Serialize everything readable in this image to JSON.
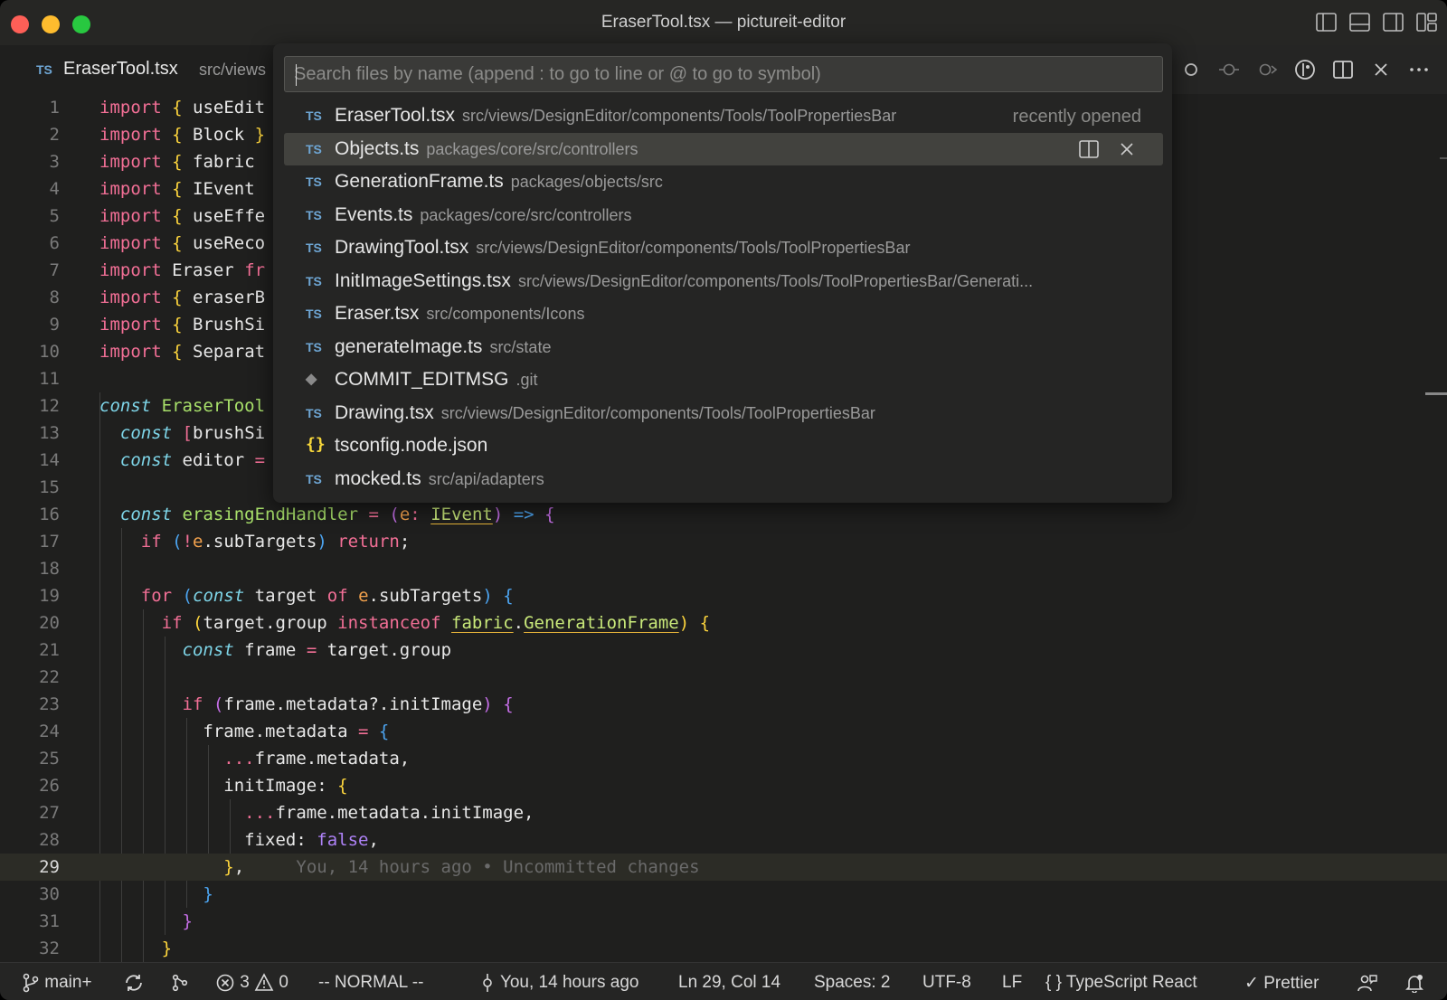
{
  "window": {
    "title": "EraserTool.tsx — pictureit-editor"
  },
  "tab": {
    "icon": "TS",
    "name": "EraserTool.tsx",
    "path": "src/views"
  },
  "quickopen": {
    "placeholder": "Search files by name (append : to go to line or @ to go to symbol)",
    "items": [
      {
        "icon": "TS",
        "name": "EraserTool.tsx",
        "desc": "src/views/DesignEditor/components/Tools/ToolPropertiesBar",
        "right": "recently opened"
      },
      {
        "icon": "TS",
        "name": "Objects.ts",
        "desc": "packages/core/src/controllers"
      },
      {
        "icon": "TS",
        "name": "GenerationFrame.ts",
        "desc": "packages/objects/src"
      },
      {
        "icon": "TS",
        "name": "Events.ts",
        "desc": "packages/core/src/controllers"
      },
      {
        "icon": "TS",
        "name": "DrawingTool.tsx",
        "desc": "src/views/DesignEditor/components/Tools/ToolPropertiesBar"
      },
      {
        "icon": "TS",
        "name": "InitImageSettings.tsx",
        "desc": "src/views/DesignEditor/components/Tools/ToolPropertiesBar/Generati..."
      },
      {
        "icon": "TS",
        "name": "Eraser.tsx",
        "desc": "src/components/Icons"
      },
      {
        "icon": "TS",
        "name": "generateImage.ts",
        "desc": "src/state"
      },
      {
        "icon": "◆",
        "name": "COMMIT_EDITMSG",
        "desc": ".git"
      },
      {
        "icon": "TS",
        "name": "Drawing.tsx",
        "desc": "src/views/DesignEditor/components/Tools/ToolPropertiesBar"
      },
      {
        "icon": "{}",
        "name": "tsconfig.node.json",
        "desc": ""
      },
      {
        "icon": "TS",
        "name": "mocked.ts",
        "desc": "src/api/adapters"
      }
    ]
  },
  "editor": {
    "line_numbers": [
      "1",
      "2",
      "3",
      "4",
      "5",
      "6",
      "7",
      "8",
      "9",
      "10",
      "11",
      "12",
      "13",
      "14",
      "15",
      "16",
      "17",
      "18",
      "19",
      "20",
      "21",
      "22",
      "23",
      "24",
      "25",
      "26",
      "27",
      "28",
      "29",
      "30",
      "31",
      "32"
    ],
    "current_line": "29",
    "code": {
      "l1_a": "useEdit",
      "l2_a": "Block",
      "l3_a": "fabric",
      "l4_a": "IEvent",
      "l5_a": "useEffe",
      "l6_a": "useReco",
      "l7_a": "Eraser",
      "l7_b": "fr",
      "l8_a": "eraserB",
      "l9_a": "BrushSi",
      "l10_a": "Separat",
      "l12_a": "EraserTool",
      "l13_a": "brushSi",
      "l14_a": "editor",
      "l16_a": "erasingEndHandler",
      "l16_b": "e",
      "l16_c": "IEvent",
      "l17_a": "e",
      "l17_b": ".subTargets",
      "l19_a": "target",
      "l19_b": "e",
      "l19_c": ".subTargets",
      "l20_a": "target.group",
      "l20_b": "fabric",
      "l20_c": "GenerationFrame",
      "l21_a": "frame",
      "l21_b": "target.group",
      "l23_a": "frame.metadata?.initImage",
      "l24_a": "frame.metadata",
      "l25_a": "frame.metadata,",
      "l26_a": "initImage:",
      "l27_a": "frame.metadata.initImage,",
      "l28_a": "fixed:",
      "l28_b": "false",
      "l29_blame": "You, 14 hours ago • Uncommitted changes"
    }
  },
  "statusbar": {
    "branch": "main+",
    "errors": "3",
    "warnings": "0",
    "mode": "-- NORMAL --",
    "blame": "You, 14 hours ago",
    "position": "Ln 29, Col 14",
    "spaces": "Spaces: 2",
    "encoding": "UTF-8",
    "eol": "LF",
    "language": "TypeScript React",
    "formatter": "Prettier"
  }
}
